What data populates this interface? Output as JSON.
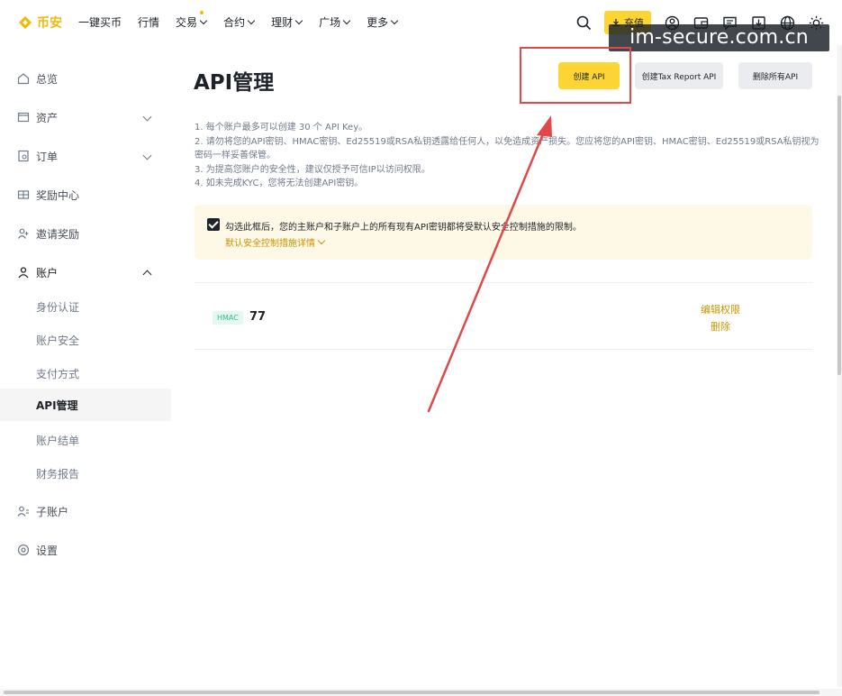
{
  "brand": {
    "name": "币安",
    "color": "#f0b90b"
  },
  "topnav": {
    "items": [
      {
        "label": "一键买币",
        "has_dropdown": false
      },
      {
        "label": "行情",
        "has_dropdown": false
      },
      {
        "label": "交易",
        "has_dropdown": true
      },
      {
        "label": "合约",
        "has_dropdown": true
      },
      {
        "label": "理财",
        "has_dropdown": true
      },
      {
        "label": "广场",
        "has_dropdown": true
      },
      {
        "label": "更多",
        "has_dropdown": true
      }
    ],
    "deposit_label": "充值",
    "icons": [
      "search-icon",
      "user-icon",
      "wallet-icon",
      "message-icon",
      "download-icon",
      "globe-icon",
      "theme-icon"
    ]
  },
  "watermark": "im-secure.com.cn",
  "sidebar": {
    "items": [
      {
        "label": "总览",
        "icon": "home-icon"
      },
      {
        "label": "资产",
        "icon": "wallet-icon",
        "chevron": "down"
      },
      {
        "label": "订单",
        "icon": "order-icon",
        "chevron": "down"
      },
      {
        "label": "奖励中心",
        "icon": "reward-icon"
      },
      {
        "label": "邀请奖励",
        "icon": "invite-icon"
      },
      {
        "label": "账户",
        "icon": "account-icon",
        "chevron": "up"
      }
    ],
    "account_sub": [
      {
        "label": "身份认证",
        "active": false
      },
      {
        "label": "账户安全",
        "active": false
      },
      {
        "label": "支付方式",
        "active": false
      },
      {
        "label": "API管理",
        "active": true
      },
      {
        "label": "账户结单",
        "active": false
      },
      {
        "label": "财务报告",
        "active": false
      }
    ],
    "bottom_items": [
      {
        "label": "子账户",
        "icon": "subaccount-icon"
      },
      {
        "label": "设置",
        "icon": "settings-icon"
      }
    ]
  },
  "main": {
    "title": "API管理",
    "buttons": {
      "create_api": "创建 API",
      "create_tax_api": "创建Tax Report API",
      "delete_all": "删除所有API"
    },
    "notes": [
      "1. 每个账户最多可以创建 30 个 API Key。",
      "2. 请勿将您的API密钥、HMAC密钥、Ed25519或RSA私钥透露给任何人，以免造成资产损失。您应将您的API密钥、HMAC密钥、Ed25519或RSA私钥视为密码一样妥善保管。",
      "3. 为提高您账户的安全性，建议仅授予可信IP以访问权限。",
      "4. 如未完成KYC，您将无法创建API密钥。"
    ],
    "alert": {
      "checked": true,
      "text": "勾选此框后，您的主账户和子账户上的所有现有API密钥都将受默认安全控制措施的限制。",
      "link": "默认安全控制措施详情"
    },
    "key": {
      "type_badge": "HMAC",
      "name": "77",
      "edit_label": "编辑权限",
      "delete_label": "删除"
    }
  },
  "colors": {
    "accent": "#fcd535",
    "link": "#c99400",
    "annotation_red": "#e0484a",
    "badge_green": "#2ebd85"
  }
}
